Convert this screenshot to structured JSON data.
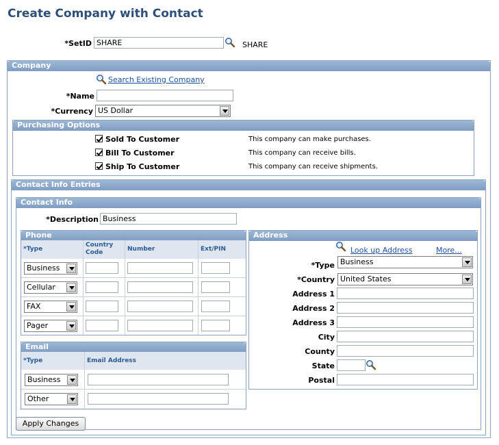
{
  "page": {
    "title": "Create Company with Contact"
  },
  "setid": {
    "label": "*SetID",
    "value": "SHARE",
    "description": "SHARE"
  },
  "company": {
    "header": "Company",
    "search_link": "Search Existing Company",
    "name_label": "*Name",
    "name_value": "",
    "currency_label": "*Currency",
    "currency_value": "US Dollar"
  },
  "purchasing": {
    "header": "Purchasing Options",
    "options": [
      {
        "label": "Sold To Customer",
        "desc": "This company can make purchases.",
        "checked": true
      },
      {
        "label": "Bill To Customer",
        "desc": "This company can receive bills.",
        "checked": true
      },
      {
        "label": "Ship To Customer",
        "desc": "This company can receive shipments.",
        "checked": true
      }
    ]
  },
  "contact_entries": {
    "header": "Contact Info Entries"
  },
  "contact_info": {
    "header": "Contact Info",
    "description_label": "*Description",
    "description_value": "Business"
  },
  "phone": {
    "header": "Phone",
    "columns": [
      "*Type",
      "Country Code",
      "Number",
      "Ext/PIN"
    ],
    "rows": [
      {
        "type": "Business"
      },
      {
        "type": "Cellular"
      },
      {
        "type": "FAX"
      },
      {
        "type": "Pager"
      }
    ]
  },
  "email": {
    "header": "Email",
    "columns": [
      "*Type",
      "Email Address"
    ],
    "rows": [
      {
        "type": "Business"
      },
      {
        "type": "Other"
      }
    ]
  },
  "address": {
    "header": "Address",
    "lookup_link": "Look up Address",
    "more_link": "More...",
    "type_label": "*Type",
    "type_value": "Business",
    "country_label": "*Country",
    "country_value": "United States",
    "fields": [
      "Address 1",
      "Address 2",
      "Address 3",
      "City",
      "County",
      "State",
      "Postal"
    ]
  },
  "apply_button": "Apply Changes",
  "colors": {
    "title": "#2d4f79",
    "header": "#8aa6c8",
    "link": "#1f4f9a",
    "column_header": "#2a5a94"
  }
}
